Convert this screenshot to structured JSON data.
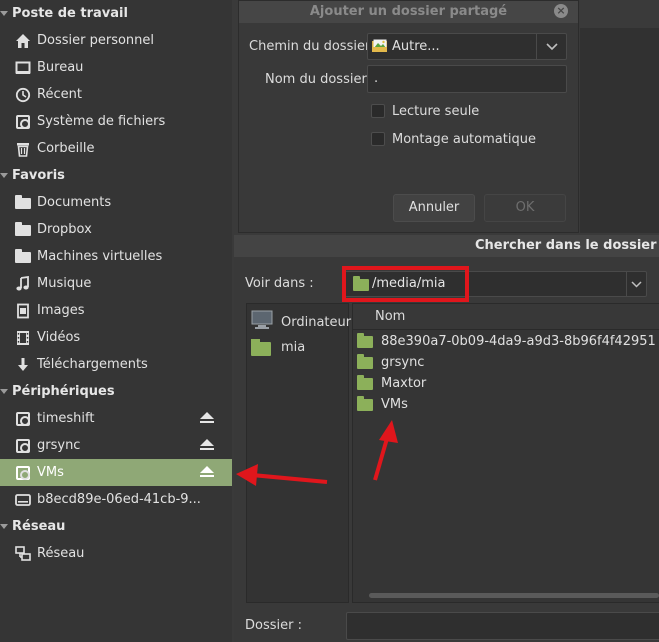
{
  "sidebar": {
    "sections": [
      {
        "title": "Poste de travail"
      },
      {
        "title": "Favoris"
      },
      {
        "title": "Périphériques"
      },
      {
        "title": "Réseau"
      }
    ],
    "workstation": [
      "Dossier personnel",
      "Bureau",
      "Récent",
      "Système de fichiers",
      "Corbeille"
    ],
    "favorites": [
      "Documents",
      "Dropbox",
      "Machines virtuelles",
      "Musique",
      "Images",
      "Vidéos",
      "Téléchargements"
    ],
    "devices": [
      "timeshift",
      "grsync",
      "VMs",
      "b8ecd89e-06ed-41cb-9..."
    ],
    "network": [
      "Réseau"
    ]
  },
  "share_dialog": {
    "title": "Ajouter un dossier partagé",
    "path_label": "Chemin du dossier :",
    "path_value": "Autre...",
    "name_label": "Nom du dossier :",
    "name_value": ".",
    "readonly_label": "Lecture seule",
    "automount_label": "Montage automatique",
    "cancel_label": "Annuler",
    "ok_label": "OK"
  },
  "chooser": {
    "title": "Chercher dans le dossier",
    "look_in_label": "Voir dans :",
    "look_in_value": "/media/mia",
    "places": [
      "Ordinateur",
      "mia"
    ],
    "column_name": "Nom",
    "files": [
      "88e390a7-0b09-4da9-a9d3-8b96f4f42951",
      "grsync",
      "Maxtor",
      "VMs"
    ],
    "folder_label": "Dossier :"
  },
  "colors": {
    "highlight": "#e0161c",
    "selection": "#8fa876",
    "folder_green": "#8cb05a"
  }
}
